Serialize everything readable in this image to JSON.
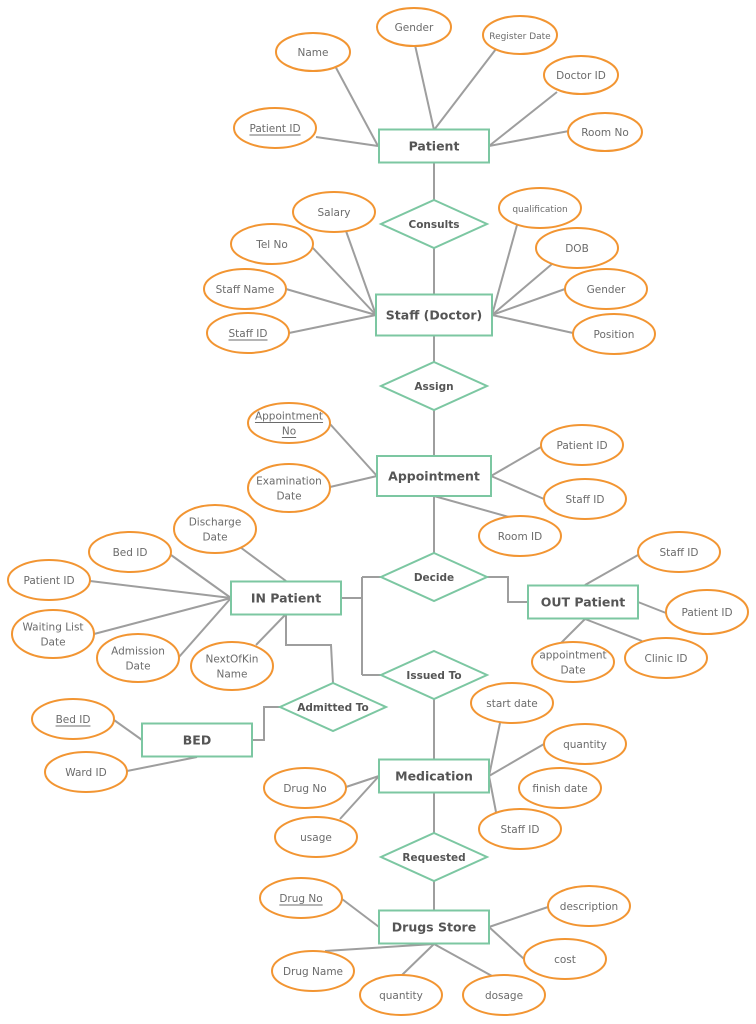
{
  "diagram": {
    "type": "er-diagram",
    "colors": {
      "entity_border": "#7cc7a2",
      "relationship_border": "#7cc7a2",
      "attribute_border": "#f29532",
      "connector": "#9e9e9e",
      "text": "#555555"
    },
    "entities": [
      {
        "id": "patient",
        "label": "Patient"
      },
      {
        "id": "staff",
        "label": "Staff (Doctor)"
      },
      {
        "id": "appointment",
        "label": "Appointment"
      },
      {
        "id": "in_patient",
        "label": "IN Patient"
      },
      {
        "id": "out_patient",
        "label": "OUT Patient"
      },
      {
        "id": "bed",
        "label": "BED"
      },
      {
        "id": "medication",
        "label": "Medication"
      },
      {
        "id": "drugs_store",
        "label": "Drugs Store"
      }
    ],
    "relationships": [
      {
        "id": "consults",
        "label": "Consults",
        "connects": [
          "patient",
          "staff"
        ]
      },
      {
        "id": "assign",
        "label": "Assign",
        "connects": [
          "staff",
          "appointment"
        ]
      },
      {
        "id": "decide",
        "label": "Decide",
        "connects": [
          "appointment",
          "in_patient",
          "out_patient"
        ]
      },
      {
        "id": "issued_to",
        "label": "Issued To",
        "connects": [
          "in_patient",
          "medication"
        ]
      },
      {
        "id": "admitted_to",
        "label": "Admitted To",
        "connects": [
          "in_patient",
          "bed"
        ]
      },
      {
        "id": "requested",
        "label": "Requested",
        "connects": [
          "medication",
          "drugs_store"
        ]
      }
    ],
    "attributes": [
      {
        "id": "p_patient_id",
        "label": [
          "Patient ID"
        ],
        "entity": "patient",
        "key": true
      },
      {
        "id": "p_name",
        "label": [
          "Name"
        ],
        "entity": "patient",
        "key": false
      },
      {
        "id": "p_gender",
        "label": [
          "Gender"
        ],
        "entity": "patient",
        "key": false
      },
      {
        "id": "p_register_date",
        "label": [
          "Register Date"
        ],
        "entity": "patient",
        "key": false
      },
      {
        "id": "p_doctor_id",
        "label": [
          "Doctor ID"
        ],
        "entity": "patient",
        "key": false
      },
      {
        "id": "p_room_no",
        "label": [
          "Room No"
        ],
        "entity": "patient",
        "key": false
      },
      {
        "id": "s_salary",
        "label": [
          "Salary"
        ],
        "entity": "staff",
        "key": false
      },
      {
        "id": "s_tel_no",
        "label": [
          "Tel No"
        ],
        "entity": "staff",
        "key": false
      },
      {
        "id": "s_staff_name",
        "label": [
          "Staff Name"
        ],
        "entity": "staff",
        "key": false
      },
      {
        "id": "s_staff_id",
        "label": [
          "Staff ID"
        ],
        "entity": "staff",
        "key": true
      },
      {
        "id": "s_qualification",
        "label": [
          "qualification"
        ],
        "entity": "staff",
        "key": false
      },
      {
        "id": "s_dob",
        "label": [
          "DOB"
        ],
        "entity": "staff",
        "key": false
      },
      {
        "id": "s_gender",
        "label": [
          "Gender"
        ],
        "entity": "staff",
        "key": false
      },
      {
        "id": "s_position",
        "label": [
          "Position"
        ],
        "entity": "staff",
        "key": false
      },
      {
        "id": "a_appointment_no",
        "label": [
          "Appointment",
          "No"
        ],
        "entity": "appointment",
        "key": true
      },
      {
        "id": "a_examination_date",
        "label": [
          "Examination",
          "Date"
        ],
        "entity": "appointment",
        "key": false
      },
      {
        "id": "a_patient_id",
        "label": [
          "Patient ID"
        ],
        "entity": "appointment",
        "key": false
      },
      {
        "id": "a_staff_id",
        "label": [
          "Staff ID"
        ],
        "entity": "appointment",
        "key": false
      },
      {
        "id": "a_room_id",
        "label": [
          "Room ID"
        ],
        "entity": "appointment",
        "key": false
      },
      {
        "id": "i_discharge_date",
        "label": [
          "Discharge",
          "Date"
        ],
        "entity": "in_patient",
        "key": false
      },
      {
        "id": "i_bed_id",
        "label": [
          "Bed ID"
        ],
        "entity": "in_patient",
        "key": false
      },
      {
        "id": "i_patient_id",
        "label": [
          "Patient ID"
        ],
        "entity": "in_patient",
        "key": false
      },
      {
        "id": "i_waiting_list_date",
        "label": [
          "Waiting List",
          "Date"
        ],
        "entity": "in_patient",
        "key": false
      },
      {
        "id": "i_admission_date",
        "label": [
          "Admission",
          "Date"
        ],
        "entity": "in_patient",
        "key": false
      },
      {
        "id": "i_next_of_kin",
        "label": [
          "NextOfKin",
          "Name"
        ],
        "entity": "in_patient",
        "key": false
      },
      {
        "id": "o_staff_id",
        "label": [
          "Staff ID"
        ],
        "entity": "out_patient",
        "key": false
      },
      {
        "id": "o_patient_id",
        "label": [
          "Patient ID"
        ],
        "entity": "out_patient",
        "key": false
      },
      {
        "id": "o_appointment_date",
        "label": [
          "appointment",
          "Date"
        ],
        "entity": "out_patient",
        "key": false
      },
      {
        "id": "o_clinic_id",
        "label": [
          "Clinic ID"
        ],
        "entity": "out_patient",
        "key": false
      },
      {
        "id": "b_bed_id",
        "label": [
          "Bed ID"
        ],
        "entity": "bed",
        "key": true
      },
      {
        "id": "b_ward_id",
        "label": [
          "Ward ID"
        ],
        "entity": "bed",
        "key": false
      },
      {
        "id": "m_start_date",
        "label": [
          "start date"
        ],
        "entity": "medication",
        "key": false
      },
      {
        "id": "m_quantity",
        "label": [
          "quantity"
        ],
        "entity": "medication",
        "key": false
      },
      {
        "id": "m_finish_date",
        "label": [
          "finish date"
        ],
        "entity": null,
        "key": false
      },
      {
        "id": "m_staff_id",
        "label": [
          "Staff ID"
        ],
        "entity": "medication",
        "key": false
      },
      {
        "id": "m_drug_no",
        "label": [
          "Drug No"
        ],
        "entity": "medication",
        "key": false
      },
      {
        "id": "m_usage",
        "label": [
          "usage"
        ],
        "entity": "medication",
        "key": false
      },
      {
        "id": "d_drug_no",
        "label": [
          "Drug No"
        ],
        "entity": "drugs_store",
        "key": true
      },
      {
        "id": "d_drug_name",
        "label": [
          "Drug Name"
        ],
        "entity": "drugs_store",
        "key": false
      },
      {
        "id": "d_quantity",
        "label": [
          "quantity"
        ],
        "entity": "drugs_store",
        "key": false
      },
      {
        "id": "d_dosage",
        "label": [
          "dosage"
        ],
        "entity": "drugs_store",
        "key": false
      },
      {
        "id": "d_description",
        "label": [
          "description"
        ],
        "entity": "drugs_store",
        "key": false
      },
      {
        "id": "d_cost",
        "label": [
          "cost"
        ],
        "entity": "drugs_store",
        "key": false
      }
    ]
  }
}
